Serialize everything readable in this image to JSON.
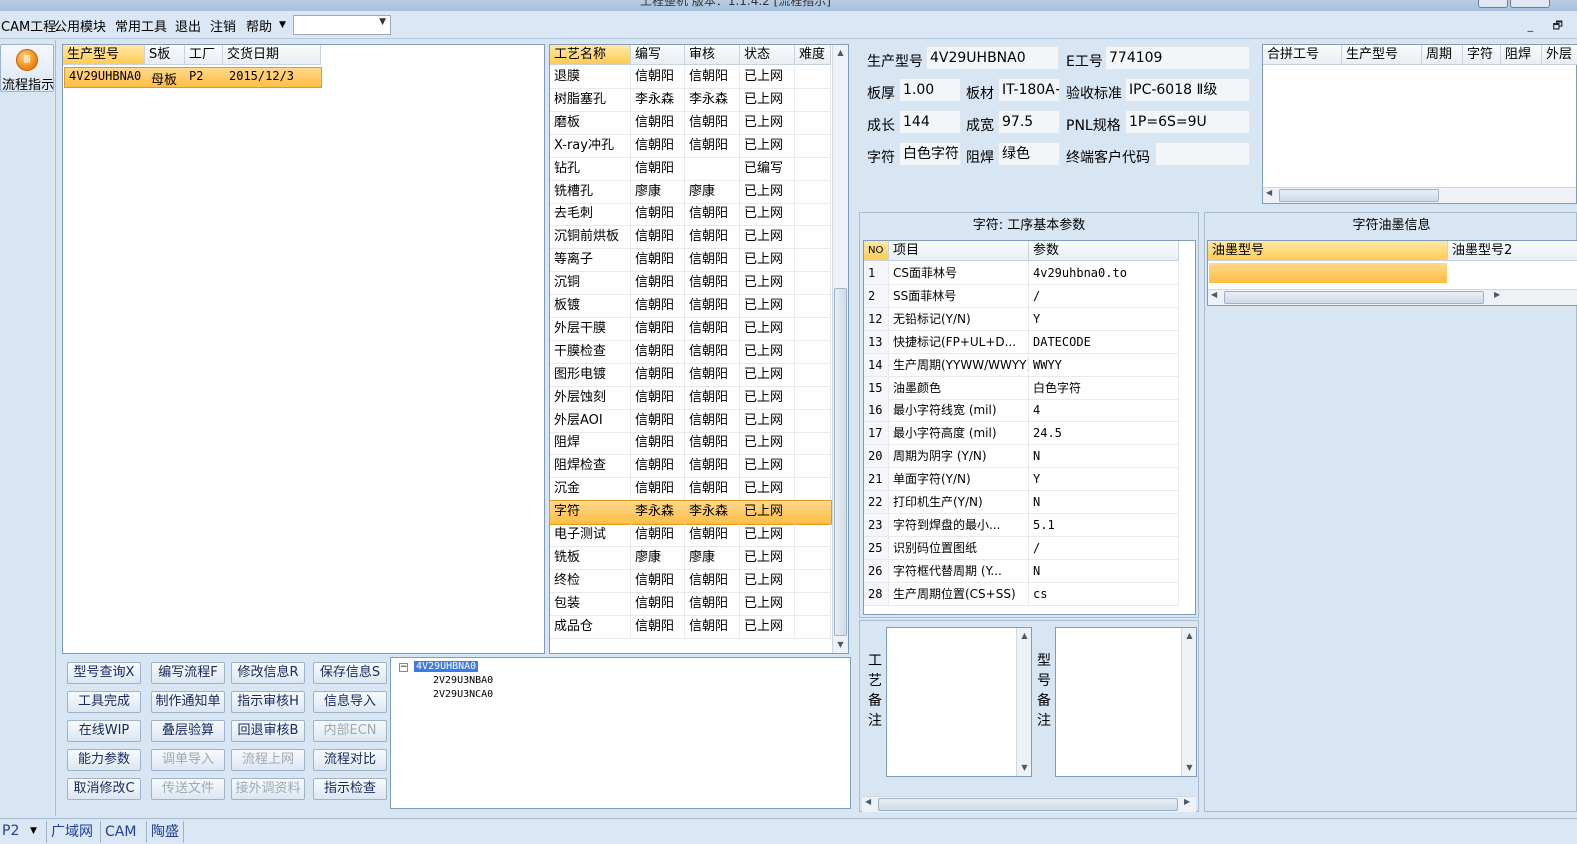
{
  "titlebar": {
    "text": "工程整机  版本：1.1.4.2  [流程指示]"
  },
  "menu": {
    "items": [
      "CAM工程",
      "公用模块",
      "常用工具",
      "退出",
      "注销",
      "帮助"
    ],
    "combo_value": ""
  },
  "leftbar": {
    "flow_button": "流程指示"
  },
  "order_grid": {
    "headers": [
      "生产型号",
      "S板",
      "工厂",
      "交货日期"
    ],
    "rows": [
      [
        "4V29UHBNA0",
        "母板",
        "P2",
        "2015/12/3"
      ]
    ]
  },
  "process_grid": {
    "headers": [
      "工艺名称",
      "编写",
      "审核",
      "状态",
      "难度"
    ],
    "rows": [
      [
        "退膜",
        "信朝阳",
        "信朝阳",
        "已上网"
      ],
      [
        "树脂塞孔",
        "李永森",
        "李永森",
        "已上网"
      ],
      [
        "磨板",
        "信朝阳",
        "信朝阳",
        "已上网"
      ],
      [
        "X-ray冲孔",
        "信朝阳",
        "信朝阳",
        "已上网"
      ],
      [
        "钻孔",
        "信朝阳",
        "",
        "已编写"
      ],
      [
        "铣槽孔",
        "廖康",
        "廖康",
        "已上网"
      ],
      [
        "去毛刺",
        "信朝阳",
        "信朝阳",
        "已上网"
      ],
      [
        "沉铜前烘板",
        "信朝阳",
        "信朝阳",
        "已上网"
      ],
      [
        "等离子",
        "信朝阳",
        "信朝阳",
        "已上网"
      ],
      [
        "沉铜",
        "信朝阳",
        "信朝阳",
        "已上网"
      ],
      [
        "板镀",
        "信朝阳",
        "信朝阳",
        "已上网"
      ],
      [
        "外层干膜",
        "信朝阳",
        "信朝阳",
        "已上网"
      ],
      [
        "干膜检查",
        "信朝阳",
        "信朝阳",
        "已上网"
      ],
      [
        "图形电镀",
        "信朝阳",
        "信朝阳",
        "已上网"
      ],
      [
        "外层蚀刻",
        "信朝阳",
        "信朝阳",
        "已上网"
      ],
      [
        "外层AOI",
        "信朝阳",
        "信朝阳",
        "已上网"
      ],
      [
        "阻焊",
        "信朝阳",
        "信朝阳",
        "已上网"
      ],
      [
        "阻焊检查",
        "信朝阳",
        "信朝阳",
        "已上网"
      ],
      [
        "沉金",
        "信朝阳",
        "信朝阳",
        "已上网"
      ],
      [
        "字符",
        "李永森",
        "李永森",
        "已上网"
      ],
      [
        "电子测试",
        "信朝阳",
        "信朝阳",
        "已上网"
      ],
      [
        "铣板",
        "廖康",
        "廖康",
        "已上网"
      ],
      [
        "终检",
        "信朝阳",
        "信朝阳",
        "已上网"
      ],
      [
        "包装",
        "信朝阳",
        "信朝阳",
        "已上网"
      ],
      [
        "成品仓",
        "信朝阳",
        "信朝阳",
        "已上网"
      ]
    ],
    "selected_index": 19
  },
  "buttons": [
    [
      "型号查询X",
      "编写流程F",
      "修改信息R",
      "保存信息S"
    ],
    [
      "工具完成",
      "制作通知单",
      "指示审核H",
      "信息导入"
    ],
    [
      "在线WIP",
      "叠层验算",
      "回退审核B",
      "内部ECN"
    ],
    [
      "能力参数",
      "调单导入",
      "流程上网",
      "流程对比"
    ],
    [
      "取消修改C",
      "传送文件",
      "接外调资料",
      "指示检查"
    ]
  ],
  "disabled_buttons": [
    "内部ECN",
    "调单导入",
    "流程上网",
    "传送文件",
    "接外调资料"
  ],
  "tree": {
    "root": "4V29UHBNA0",
    "children": [
      "2V29U3NBA0",
      "2V29U3NCA0"
    ]
  },
  "info_form": {
    "model_label": "生产型号",
    "model": "4V29UHBNA0",
    "eno_label": "E工号",
    "eno": "774109",
    "thickness_label": "板厚",
    "thickness": "1.00",
    "material_label": "板材",
    "material": "IT-180A+",
    "standard_label": "验收标准",
    "standard": "IPC-6018 Ⅱ级",
    "length_label": "成长",
    "length": "144",
    "width_label": "成宽",
    "width": "97.5",
    "pnl_label": "PNL规格",
    "pnl": "1P=6S=9U",
    "char_label": "字符",
    "char": "白色字符",
    "mask_label": "阻焊",
    "mask": "绿色",
    "customer_label": "终端客户代码",
    "customer": ""
  },
  "combo_grid": {
    "headers": [
      "合拼工号",
      "生产型号",
      "周期",
      "字符",
      "阻焊",
      "外层"
    ]
  },
  "params": {
    "title": "字符: 工序基本参数",
    "headers": [
      "NO",
      "项目",
      "参数"
    ],
    "rows": [
      [
        "1",
        "CS面菲林号",
        "4v29uhbna0.to"
      ],
      [
        "2",
        "SS面菲林号",
        "/"
      ],
      [
        "12",
        "无铅标记(Y/N)",
        "Y"
      ],
      [
        "13",
        "快捷标记(FP+UL+D...",
        "DATECODE"
      ],
      [
        "14",
        "生产周期(YYWW/WWYY)",
        "WWYY"
      ],
      [
        "15",
        "油墨颜色",
        "白色字符"
      ],
      [
        "16",
        "最小字符线宽 (mil)",
        "4"
      ],
      [
        "17",
        "最小字符高度 (mil)",
        "24.5"
      ],
      [
        "20",
        "周期为阴字 (Y/N)",
        "N"
      ],
      [
        "21",
        "单面字符(Y/N)",
        "Y"
      ],
      [
        "22",
        "打印机生产(Y/N)",
        "N"
      ],
      [
        "23",
        "字符到焊盘的最小...",
        "5.1"
      ],
      [
        "25",
        "识别码位置图纸",
        "/"
      ],
      [
        "26",
        "字符框代替周期 (Y...",
        "N"
      ],
      [
        "28",
        "生产周期位置(CS+SS)",
        "cs"
      ]
    ]
  },
  "ink": {
    "title": "字符油墨信息",
    "headers": [
      "油墨型号",
      "油墨型号2"
    ]
  },
  "notes": {
    "process_label": "工艺备注",
    "model_label": "型号备注"
  },
  "status": {
    "combo": "P2",
    "tabs": [
      "广域网",
      "CAM",
      "陶盛"
    ]
  }
}
